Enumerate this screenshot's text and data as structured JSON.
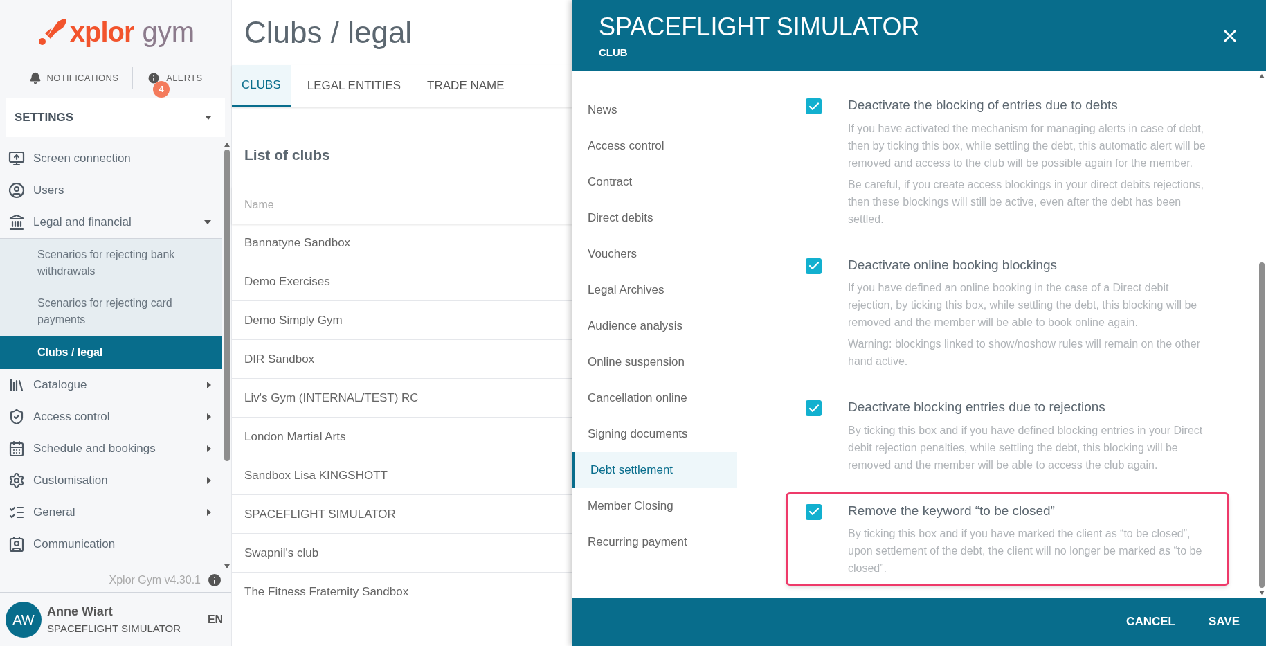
{
  "logo": {
    "brand": "xplor",
    "product": "gym"
  },
  "top_links": [
    {
      "label": "NOTIFICATIONS",
      "kind": "bell"
    },
    {
      "label": "ALERTS",
      "kind": "info",
      "badge": "4"
    }
  ],
  "settings_dropdown": {
    "value": "SETTINGS"
  },
  "sidebar": {
    "items": [
      {
        "label": "Screen connection",
        "kind": "link",
        "selected": false
      },
      {
        "label": "Users",
        "kind": "link",
        "selected": false
      },
      {
        "label": "Legal and financial",
        "kind": "group",
        "selected": false,
        "expanded": true,
        "children": [
          {
            "label": "Scenarios for rejecting bank withdrawals",
            "selected": false
          },
          {
            "label": "Scenarios for rejecting card payments",
            "selected": false
          },
          {
            "label": "Clubs / legal",
            "selected": true
          }
        ]
      },
      {
        "label": "Catalogue",
        "kind": "group",
        "selected": false,
        "expanded": false
      },
      {
        "label": "Access control",
        "kind": "group",
        "selected": false,
        "expanded": false
      },
      {
        "label": "Schedule and bookings",
        "kind": "group",
        "selected": false,
        "expanded": false
      },
      {
        "label": "Customisation",
        "kind": "group",
        "selected": false,
        "expanded": false
      },
      {
        "label": "General",
        "kind": "group",
        "selected": false,
        "expanded": false
      },
      {
        "label": "Communication",
        "kind": "link",
        "selected": false
      }
    ]
  },
  "version": "Xplor Gym v4.30.1",
  "user": {
    "initials": "AW",
    "name": "Anne Wiart",
    "club": "SPACEFLIGHT SIMULATOR",
    "language": "EN"
  },
  "page": {
    "title": "Clubs / legal",
    "tabs": [
      {
        "label": "CLUBS",
        "selected": true
      },
      {
        "label": "LEGAL ENTITIES",
        "selected": false
      },
      {
        "label": "TRADE NAME",
        "selected": false
      }
    ],
    "list_title": "List of clubs",
    "table": {
      "columns": [
        "Name"
      ],
      "rows": [
        [
          "Bannatyne Sandbox"
        ],
        [
          "Demo Exercises"
        ],
        [
          "Demo Simply Gym"
        ],
        [
          "DIR Sandbox"
        ],
        [
          "Liv's Gym (INTERNAL/TEST) RC"
        ],
        [
          "London Martial Arts"
        ],
        [
          "Sandbox Lisa KINGSHOTT"
        ],
        [
          "SPACEFLIGHT SIMULATOR"
        ],
        [
          "Swapnil's club"
        ],
        [
          "The Fitness Fraternity Sandbox"
        ]
      ]
    }
  },
  "panel": {
    "title": "SPACEFLIGHT SIMULATOR",
    "subtitle": "CLUB",
    "nav": [
      {
        "label": "News",
        "selected": false
      },
      {
        "label": "Access control",
        "selected": false
      },
      {
        "label": "Contract",
        "selected": false
      },
      {
        "label": "Direct debits",
        "selected": false
      },
      {
        "label": "Vouchers",
        "selected": false
      },
      {
        "label": "Legal Archives",
        "selected": false
      },
      {
        "label": "Audience analysis",
        "selected": false
      },
      {
        "label": "Online suspension",
        "selected": false
      },
      {
        "label": "Cancellation online",
        "selected": false
      },
      {
        "label": "Signing documents",
        "selected": false
      },
      {
        "label": "Debt settlement",
        "selected": true
      },
      {
        "label": "Member Closing",
        "selected": false
      },
      {
        "label": "Recurring payment",
        "selected": false
      }
    ],
    "options": [
      {
        "title": "Deactivate the blocking of entries due to debts",
        "checked": true,
        "highlighted": false,
        "paragraphs": [
          "If you have activated the mechanism for managing alerts in case of debt, then by ticking this box, while settling the debt, this automatic alert will be removed and access to the club will be possible again for the member.",
          "Be careful, if you create access blockings in your direct debits rejections, then these blockings will still be active, even after the debt has been settled."
        ]
      },
      {
        "title": "Deactivate online booking blockings",
        "checked": true,
        "highlighted": false,
        "paragraphs": [
          "If you have defined an online booking in the case of a Direct debit rejection, by ticking this box, while settling the debt, this blocking will be removed and the member will be able to book online again.",
          "Warning: blockings linked to show/noshow rules will remain on the other hand active."
        ]
      },
      {
        "title": "Deactivate blocking entries due to rejections",
        "checked": true,
        "highlighted": false,
        "paragraphs": [
          "By ticking this box and if you have defined blocking entries in your Direct debit rejection penalties, while settling the debt, this blocking will be removed and the member will be able to access the club again."
        ]
      },
      {
        "title": "Remove the keyword “to be closed”",
        "checked": true,
        "highlighted": true,
        "paragraphs": [
          "By ticking this box and if you have marked the client as “to be closed”, upon settlement of the debt, the client will no longer be marked as “to be closed”."
        ]
      }
    ],
    "buttons": [
      "CANCEL",
      "SAVE"
    ]
  }
}
